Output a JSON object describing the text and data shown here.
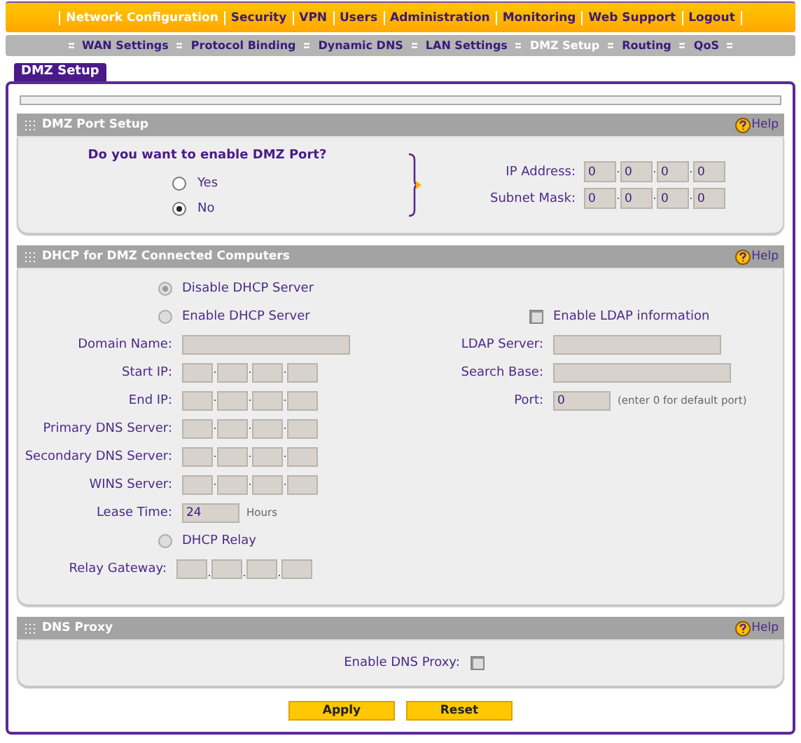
{
  "main_menu": [
    {
      "label": "Network Configuration",
      "selected": true
    },
    {
      "label": "Security",
      "selected": false
    },
    {
      "label": "VPN",
      "selected": false
    },
    {
      "label": "Users",
      "selected": false
    },
    {
      "label": "Administration",
      "selected": false
    },
    {
      "label": "Monitoring",
      "selected": false
    },
    {
      "label": "Web Support",
      "selected": false
    },
    {
      "label": "Logout",
      "selected": false
    }
  ],
  "sub_menu": [
    {
      "label": "WAN Settings",
      "selected": false
    },
    {
      "label": "Protocol Binding",
      "selected": false
    },
    {
      "label": "Dynamic DNS",
      "selected": false
    },
    {
      "label": "LAN Settings",
      "selected": false
    },
    {
      "label": "DMZ Setup",
      "selected": true
    },
    {
      "label": "Routing",
      "selected": false
    },
    {
      "label": "QoS",
      "selected": false
    }
  ],
  "page_tab": "DMZ Setup",
  "dmz_port_setup": {
    "title": "DMZ Port Setup",
    "help": "Help",
    "question": "Do you want to enable DMZ Port?",
    "options": [
      {
        "label": "Yes",
        "selected": false
      },
      {
        "label": "No",
        "selected": true
      }
    ],
    "addresses": [
      {
        "label": "IP Address:",
        "octets": [
          "0",
          "0",
          "0",
          "0"
        ]
      },
      {
        "label": "Subnet Mask:",
        "octets": [
          "0",
          "0",
          "0",
          "0"
        ]
      }
    ]
  },
  "dhcp": {
    "title": "DHCP for DMZ Connected Computers",
    "help": "Help",
    "mode_options": [
      {
        "label": "Disable DHCP Server",
        "selected": true,
        "disabled": true
      },
      {
        "label": "Enable DHCP Server",
        "selected": false,
        "disabled": true
      }
    ],
    "fields": [
      {
        "label": "Domain Name:",
        "kind": "text"
      },
      {
        "label": "Start IP:",
        "kind": "ip"
      },
      {
        "label": "End IP:",
        "kind": "ip"
      },
      {
        "label": "Primary DNS Server:",
        "kind": "ip"
      },
      {
        "label": "Secondary DNS Server:",
        "kind": "ip"
      },
      {
        "label": "WINS Server:",
        "kind": "ip"
      },
      {
        "label": "Lease Time:",
        "kind": "short",
        "value": "24",
        "unit": "Hours"
      }
    ],
    "relay_option": {
      "label": "DHCP Relay",
      "selected": false,
      "disabled": true
    },
    "relay_gateway": {
      "label": "Relay Gateway:"
    },
    "ldap": {
      "label": "Enable LDAP information",
      "checked": false
    },
    "ldap_fields": [
      {
        "label": "LDAP Server:",
        "kind": "text"
      },
      {
        "label": "Search Base:",
        "kind": "wide"
      },
      {
        "label": "Port:",
        "kind": "short",
        "value": "0",
        "unit": "(enter 0 for default port)"
      }
    ]
  },
  "dns_proxy": {
    "title": "DNS Proxy",
    "help": "Help",
    "label": "Enable DNS Proxy:",
    "checked": false
  },
  "buttons": [
    "Apply",
    "Reset"
  ]
}
